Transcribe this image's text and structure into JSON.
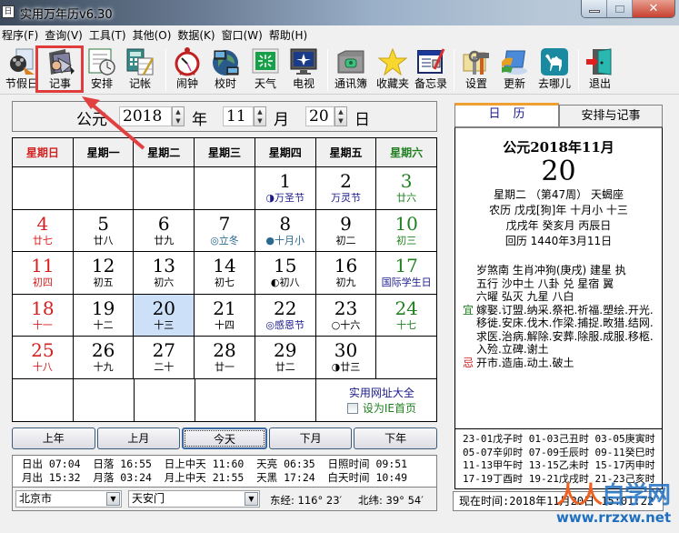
{
  "window": {
    "title": "实用万年历v6.30",
    "icon_text": "日"
  },
  "menu": [
    "程序(F)",
    "查询(V)",
    "工具(T)",
    "其他(O)",
    "数据(K)",
    "窗口(W)",
    "帮助(H)"
  ],
  "toolbar": [
    {
      "label": "节假日",
      "icon": "film-holiday-icon"
    },
    {
      "label": "记事",
      "icon": "notebook-pen-icon"
    },
    {
      "label": "安排",
      "icon": "schedule-clock-icon"
    },
    {
      "label": "记帐",
      "icon": "calculator-ledger-icon"
    },
    {
      "label": "闹钟",
      "icon": "alarm-clock-icon"
    },
    {
      "label": "校时",
      "icon": "globe-computer-icon"
    },
    {
      "label": "天气",
      "icon": "weather-icon"
    },
    {
      "label": "电视",
      "icon": "tv-icon"
    },
    {
      "label": "通讯簿",
      "icon": "phone-book-icon"
    },
    {
      "label": "收藏夹",
      "icon": "star-icon"
    },
    {
      "label": "备忘录",
      "icon": "memo-icon"
    },
    {
      "label": "设置",
      "icon": "tools-icon"
    },
    {
      "label": "更新",
      "icon": "update-icon"
    },
    {
      "label": "去哪儿",
      "icon": "camel-icon"
    },
    {
      "label": "退出",
      "icon": "exit-door-icon"
    }
  ],
  "date_selector": {
    "era": "公元",
    "year": "2018",
    "year_unit": "年",
    "month": "11",
    "month_unit": "月",
    "day": "20",
    "day_unit": "日"
  },
  "calendar": {
    "weekdays": [
      "星期日",
      "星期一",
      "星期二",
      "星期三",
      "星期四",
      "星期五",
      "星期六"
    ],
    "weeks": [
      [
        {
          "d": "",
          "l": ""
        },
        {
          "d": "",
          "l": ""
        },
        {
          "d": "",
          "l": ""
        },
        {
          "d": "",
          "l": ""
        },
        {
          "d": "1",
          "l": "◑万圣节",
          "lc": "blue"
        },
        {
          "d": "2",
          "l": "万灵节",
          "lc": "blue"
        },
        {
          "d": "3",
          "l": "廿六",
          "c": "green"
        }
      ],
      [
        {
          "d": "4",
          "l": "廿七",
          "c": "red"
        },
        {
          "d": "5",
          "l": "廿八"
        },
        {
          "d": "6",
          "l": "廿九"
        },
        {
          "d": "7",
          "l": "◎立冬",
          "lc": "teal"
        },
        {
          "d": "8",
          "l": "●十月小",
          "lc": "teal"
        },
        {
          "d": "9",
          "l": "初二"
        },
        {
          "d": "10",
          "l": "初三",
          "c": "green"
        }
      ],
      [
        {
          "d": "11",
          "l": "初四",
          "c": "red"
        },
        {
          "d": "12",
          "l": "初五"
        },
        {
          "d": "13",
          "l": "初六"
        },
        {
          "d": "14",
          "l": "初七"
        },
        {
          "d": "15",
          "l": "◐初八"
        },
        {
          "d": "16",
          "l": "初九"
        },
        {
          "d": "17",
          "l": "国际学生日",
          "c": "green",
          "lc": "blue"
        }
      ],
      [
        {
          "d": "18",
          "l": "十一",
          "c": "red"
        },
        {
          "d": "19",
          "l": "十二"
        },
        {
          "d": "20",
          "l": "十三",
          "today": true
        },
        {
          "d": "21",
          "l": "十四"
        },
        {
          "d": "22",
          "l": "◎感恩节",
          "lc": "blue"
        },
        {
          "d": "23",
          "l": "○十六"
        },
        {
          "d": "24",
          "l": "十七",
          "c": "green"
        }
      ],
      [
        {
          "d": "25",
          "l": "十八",
          "c": "red"
        },
        {
          "d": "26",
          "l": "十九"
        },
        {
          "d": "27",
          "l": "二十"
        },
        {
          "d": "28",
          "l": "廿一"
        },
        {
          "d": "29",
          "l": "廿二"
        },
        {
          "d": "30",
          "l": "◑廿三"
        },
        {
          "d": "",
          "l": ""
        }
      ]
    ],
    "link_sites": "实用网址大全",
    "set_homepage": "设为IE首页"
  },
  "nav": [
    "上年",
    "上月",
    "今天",
    "下月",
    "下年"
  ],
  "sun_moon": {
    "line1": "日出 07:04  日落 16:55  日上中天 11:60  天亮 06:35  日照时间 09:51",
    "line2": "月出 15:32  月落 03:24  月上中天 21:55  天黑 17:24  白天时间 10:49"
  },
  "location": {
    "city": "北京市",
    "district": "天安门",
    "longitude": "东经: 116° 23′",
    "latitude": "北纬: 39° 54′"
  },
  "tabs": [
    "日历",
    "安排与记事"
  ],
  "day_info": {
    "year_month": "公元2018年11月",
    "day": "20",
    "line1": "星期二 （第47周） 天蝎座",
    "line2": "农历 戊戌[狗]年 十月小 十三",
    "line3": "戊戌年 癸亥月 丙辰日",
    "line4": "回历 1440年3月11日",
    "almanac": [
      "岁煞南 生肖冲狗(庚戌)  建星 执",
      "五行 沙中土  八卦 兑  星宿 翼",
      "六曜 弘灭  九星 八白"
    ],
    "yi_label": "宜",
    "yi": "嫁娶.订盟.纳采.祭祀.祈福.塑绘.开光.移徙.安床.伐木.作梁.捕捉.畋猎.结网.求医.治病.解除.安葬.除服.成服.移柩.入殓.立碑.谢土",
    "ji_label": "忌",
    "ji": "开市.造庙.动土.破土"
  },
  "hours": [
    "23-01戊子时 01-03己丑时 03-05庚寅时",
    "05-07辛卯时 07-09壬辰时 09-11癸巳时",
    "11-13甲午时 13-15乙未时 15-17丙申时",
    "17-19丁酉时 19-21戊戌时 21-23己亥时"
  ],
  "now": "现在时间:2018年11月20日 15:01:22",
  "watermark": {
    "top": "人人自学网",
    "url": "www.rrzxw.net"
  },
  "colors": {
    "sunday": "#d42020",
    "saturday": "#208020",
    "festival": "#1a1a8c",
    "today_bg": "#cce0f8",
    "highlight": "#e03c3c"
  }
}
